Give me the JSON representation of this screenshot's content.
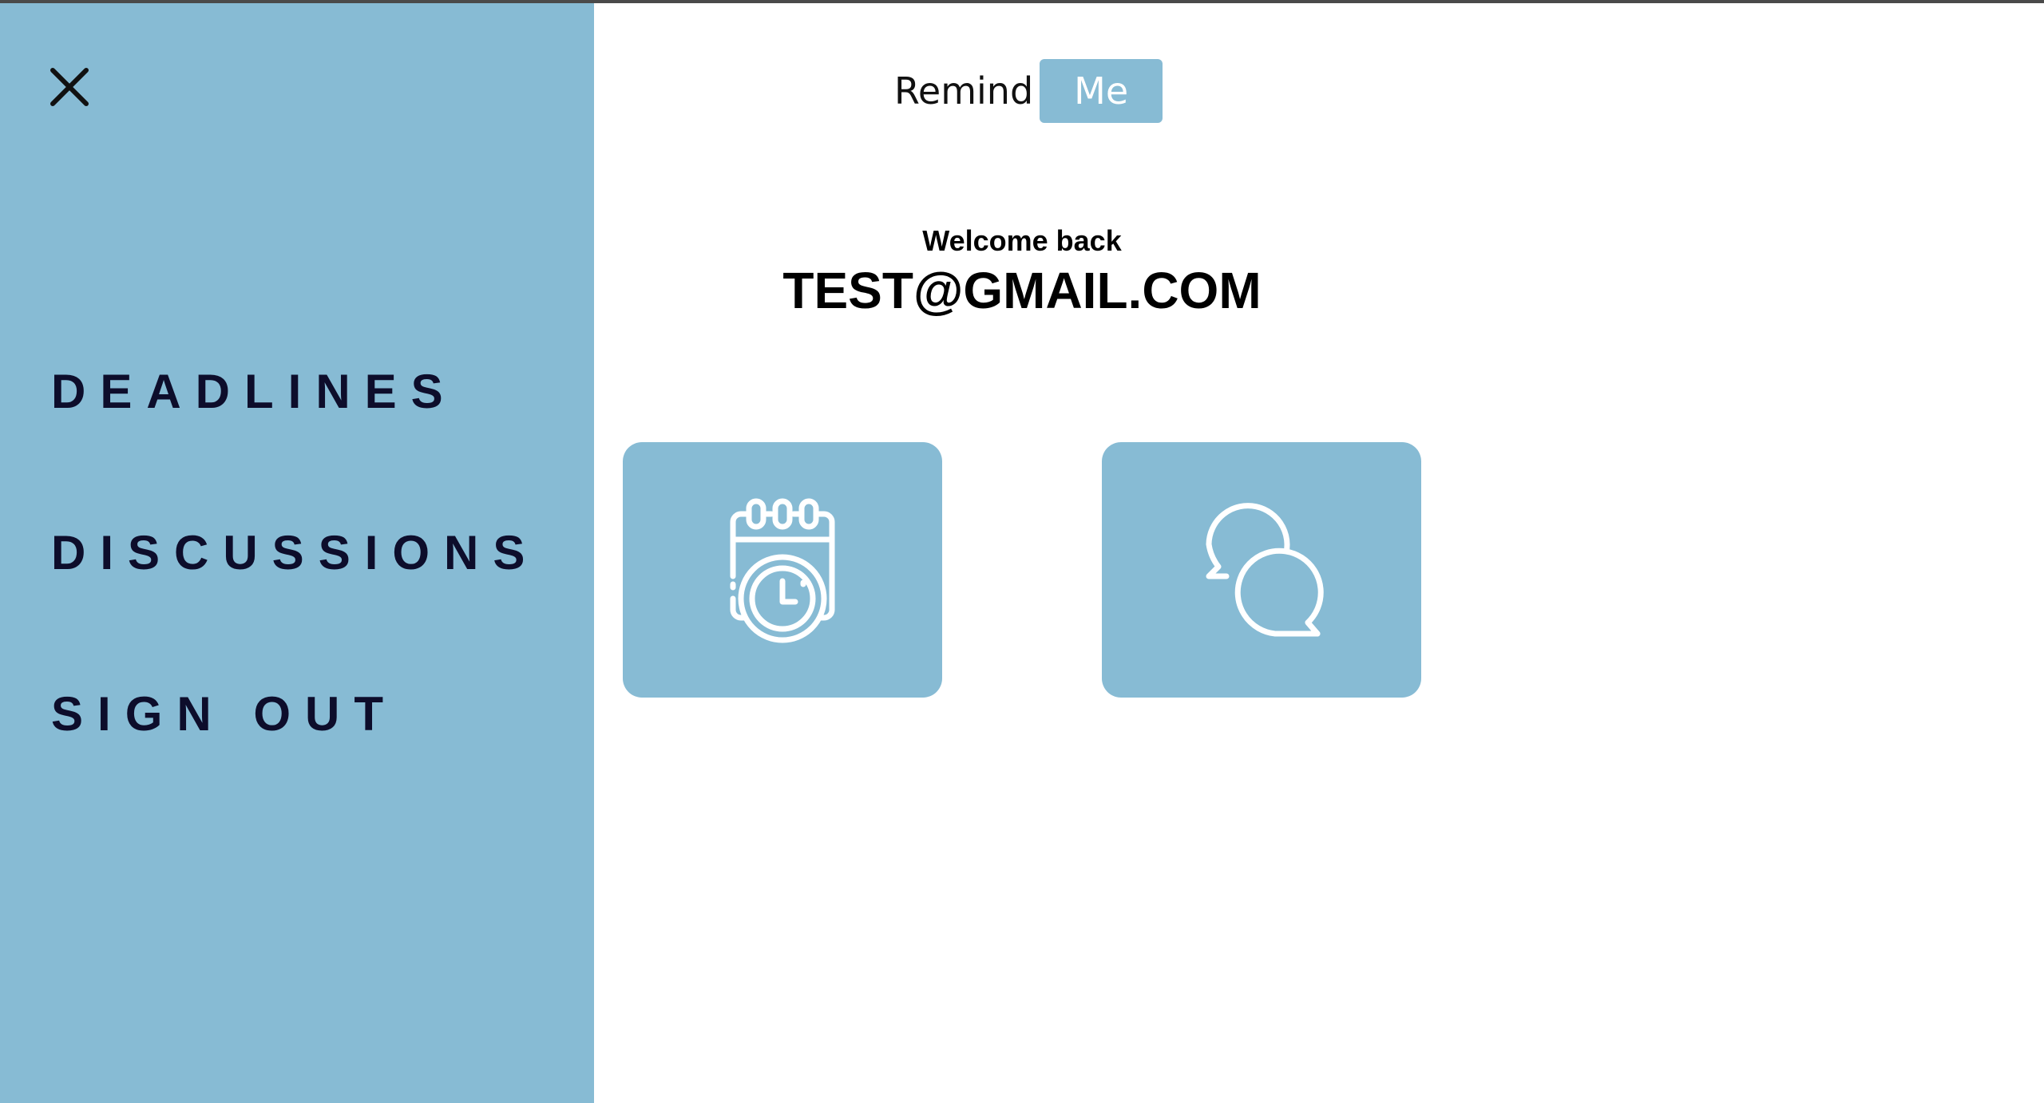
{
  "sidebar": {
    "close_icon": "close-icon",
    "items": [
      {
        "label": "DEADLINES"
      },
      {
        "label": "DISCUSSIONS"
      },
      {
        "label": "SIGN OUT"
      }
    ]
  },
  "header": {
    "logo_part1": "Remind",
    "logo_part2": "Me"
  },
  "main": {
    "welcome_text": "Welcome back",
    "user_email": "TEST@GMAIL.COM",
    "tiles": [
      {
        "icon": "calendar-clock-icon"
      },
      {
        "icon": "chat-bubbles-icon"
      }
    ]
  },
  "colors": {
    "accent": "#87bbd4",
    "nav_text": "#0d0d2b",
    "background": "#ffffff"
  }
}
